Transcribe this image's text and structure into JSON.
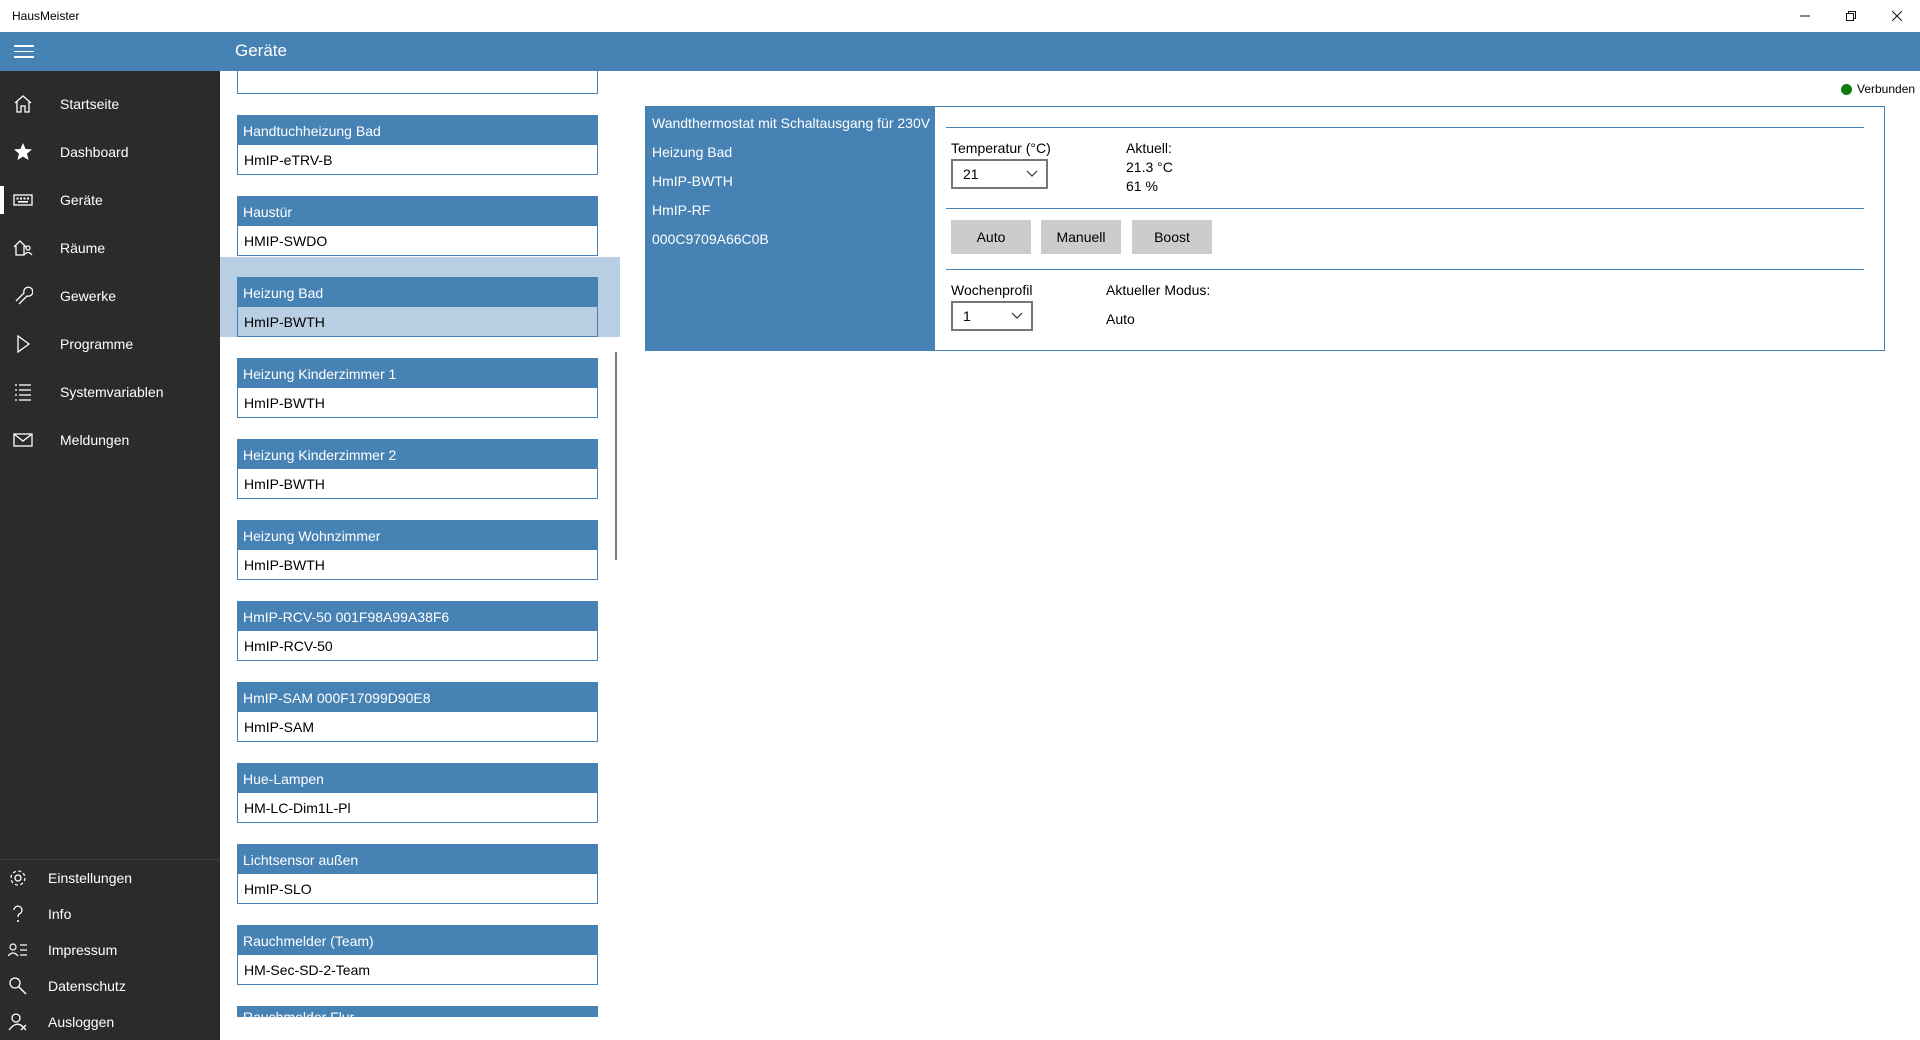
{
  "app": {
    "title": "HausMeister"
  },
  "window": {
    "minimize_icon": "minimize-icon",
    "maximize_icon": "restore-icon",
    "close_icon": "close-icon"
  },
  "header": {
    "title": "Geräte"
  },
  "sidebar": {
    "items": [
      {
        "label": "Startseite",
        "icon": "home-icon"
      },
      {
        "label": "Dashboard",
        "icon": "star-icon"
      },
      {
        "label": "Geräte",
        "icon": "keyboard-icon"
      },
      {
        "label": "Räume",
        "icon": "rooms-icon"
      },
      {
        "label": "Gewerke",
        "icon": "wrench-icon"
      },
      {
        "label": "Programme",
        "icon": "play-icon"
      },
      {
        "label": "Systemvariablen",
        "icon": "list-icon"
      },
      {
        "label": "Meldungen",
        "icon": "mail-icon"
      }
    ],
    "bottom_items": [
      {
        "label": "Einstellungen",
        "icon": "gear-icon"
      },
      {
        "label": "Info",
        "icon": "question-icon"
      },
      {
        "label": "Impressum",
        "icon": "contact-icon"
      },
      {
        "label": "Datenschutz",
        "icon": "search-person-icon"
      },
      {
        "label": "Ausloggen",
        "icon": "logout-person-icon"
      }
    ]
  },
  "devices": [
    {
      "name": "Handtuchheizung Bad",
      "type": "HmIP-eTRV-B"
    },
    {
      "name": "Haustür",
      "type": "HMIP-SWDO"
    },
    {
      "name": "Heizung Bad",
      "type": "HmIP-BWTH",
      "selected": true
    },
    {
      "name": "Heizung Kinderzimmer 1",
      "type": "HmIP-BWTH"
    },
    {
      "name": "Heizung Kinderzimmer 2",
      "type": "HmIP-BWTH"
    },
    {
      "name": "Heizung Wohnzimmer",
      "type": "HmIP-BWTH"
    },
    {
      "name": "HmIP-RCV-50 001F98A99A38F6",
      "type": "HmIP-RCV-50"
    },
    {
      "name": "HmIP-SAM 000F17099D90E8",
      "type": "HmIP-SAM"
    },
    {
      "name": "Hue-Lampen",
      "type": "HM-LC-Dim1L-Pl"
    },
    {
      "name": "Lichtsensor außen",
      "type": "HmIP-SLO"
    },
    {
      "name": "Rauchmelder (Team)",
      "type": "HM-Sec-SD-2-Team"
    },
    {
      "name": "Rauchmelder Flur",
      "type": ""
    }
  ],
  "status": {
    "label": "Verbunden",
    "color": "#107c10"
  },
  "detail": {
    "description": "Wandthermostat mit Schaltausgang für 230V",
    "name": "Heizung Bad",
    "type": "HmIP-BWTH",
    "interface": "HmIP-RF",
    "address": "000C9709A66C0B",
    "temperature_label": "Temperatur (°C)",
    "temperature_value": "21",
    "current_label": "Aktuell:",
    "current_temp": "21.3 °C",
    "current_humidity": "61 %",
    "buttons": {
      "auto": "Auto",
      "manual": "Manuell",
      "boost": "Boost"
    },
    "profile_label": "Wochenprofil",
    "profile_value": "1",
    "mode_label": "Aktueller Modus:",
    "mode_value": "Auto"
  },
  "colors": {
    "accent": "#4682b4",
    "sidebar": "#2b2b2b",
    "selection": "#b8cfe3"
  }
}
